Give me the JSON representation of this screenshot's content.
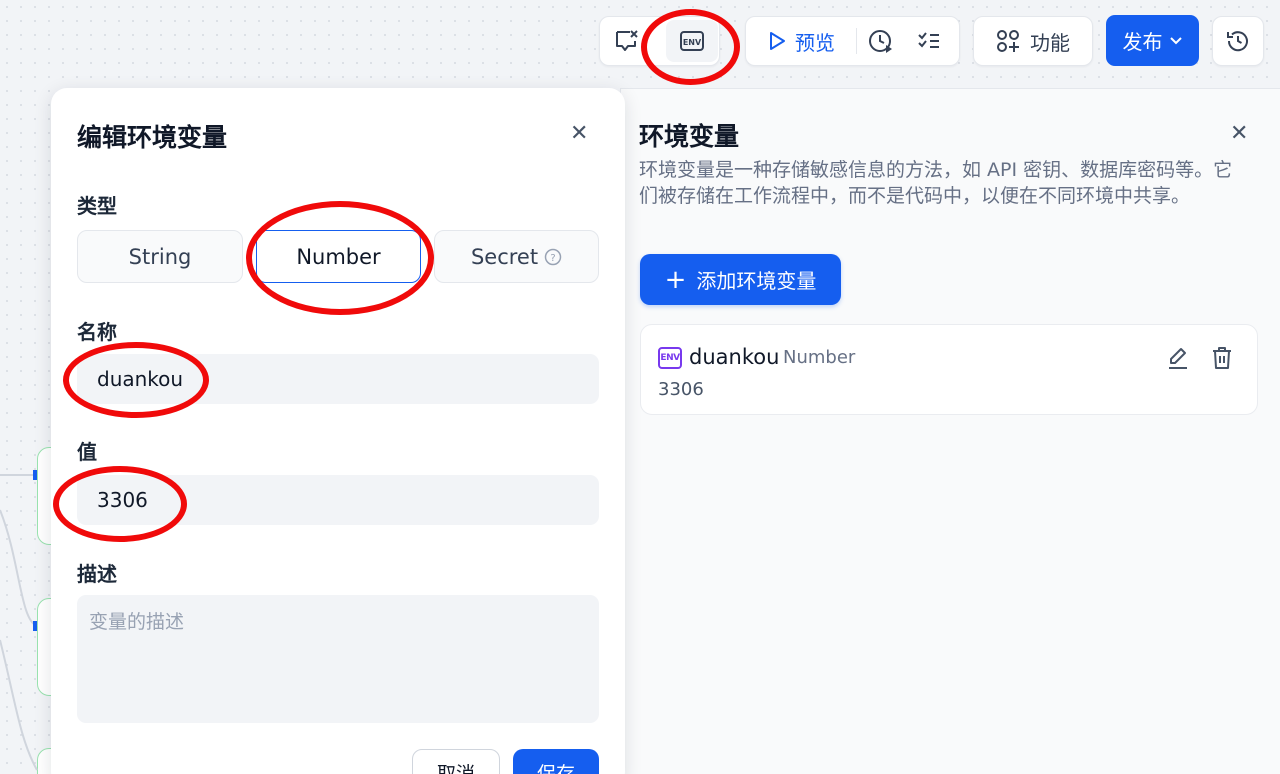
{
  "toolbar": {
    "preview_label": "预览",
    "features_label": "功能",
    "publish_label": "发布"
  },
  "edit_panel": {
    "title": "编辑环境变量",
    "type_label": "类型",
    "types": [
      "String",
      "Number",
      "Secret"
    ],
    "selected_type": "Number",
    "name_label": "名称",
    "name_value": "duankou",
    "value_label": "值",
    "value_value": "3306",
    "desc_label": "描述",
    "desc_placeholder": "变量的描述",
    "cancel_label": "取消",
    "save_label": "保存"
  },
  "env_panel": {
    "title": "环境变量",
    "description": "环境变量是一种存储敏感信息的方法，如 API 密钥、数据库密码等。它们被存储在工作流程中，而不是代码中，以便在不同环境中共享。",
    "add_button_label": "添加环境变量",
    "variables": [
      {
        "badge": "ENV",
        "name": "duankou",
        "type": "Number",
        "value": "3306"
      }
    ]
  },
  "colors": {
    "primary": "#155eef",
    "annotation": "#f00a0a",
    "env_badge": "#7839ee"
  },
  "icons": [
    "feedback-icon",
    "env-icon",
    "play-icon",
    "run-history-icon",
    "checklist-icon",
    "features-icon",
    "chevron-down-icon",
    "history-icon",
    "close-icon",
    "help-icon",
    "plus-icon",
    "edit-icon",
    "delete-icon"
  ]
}
